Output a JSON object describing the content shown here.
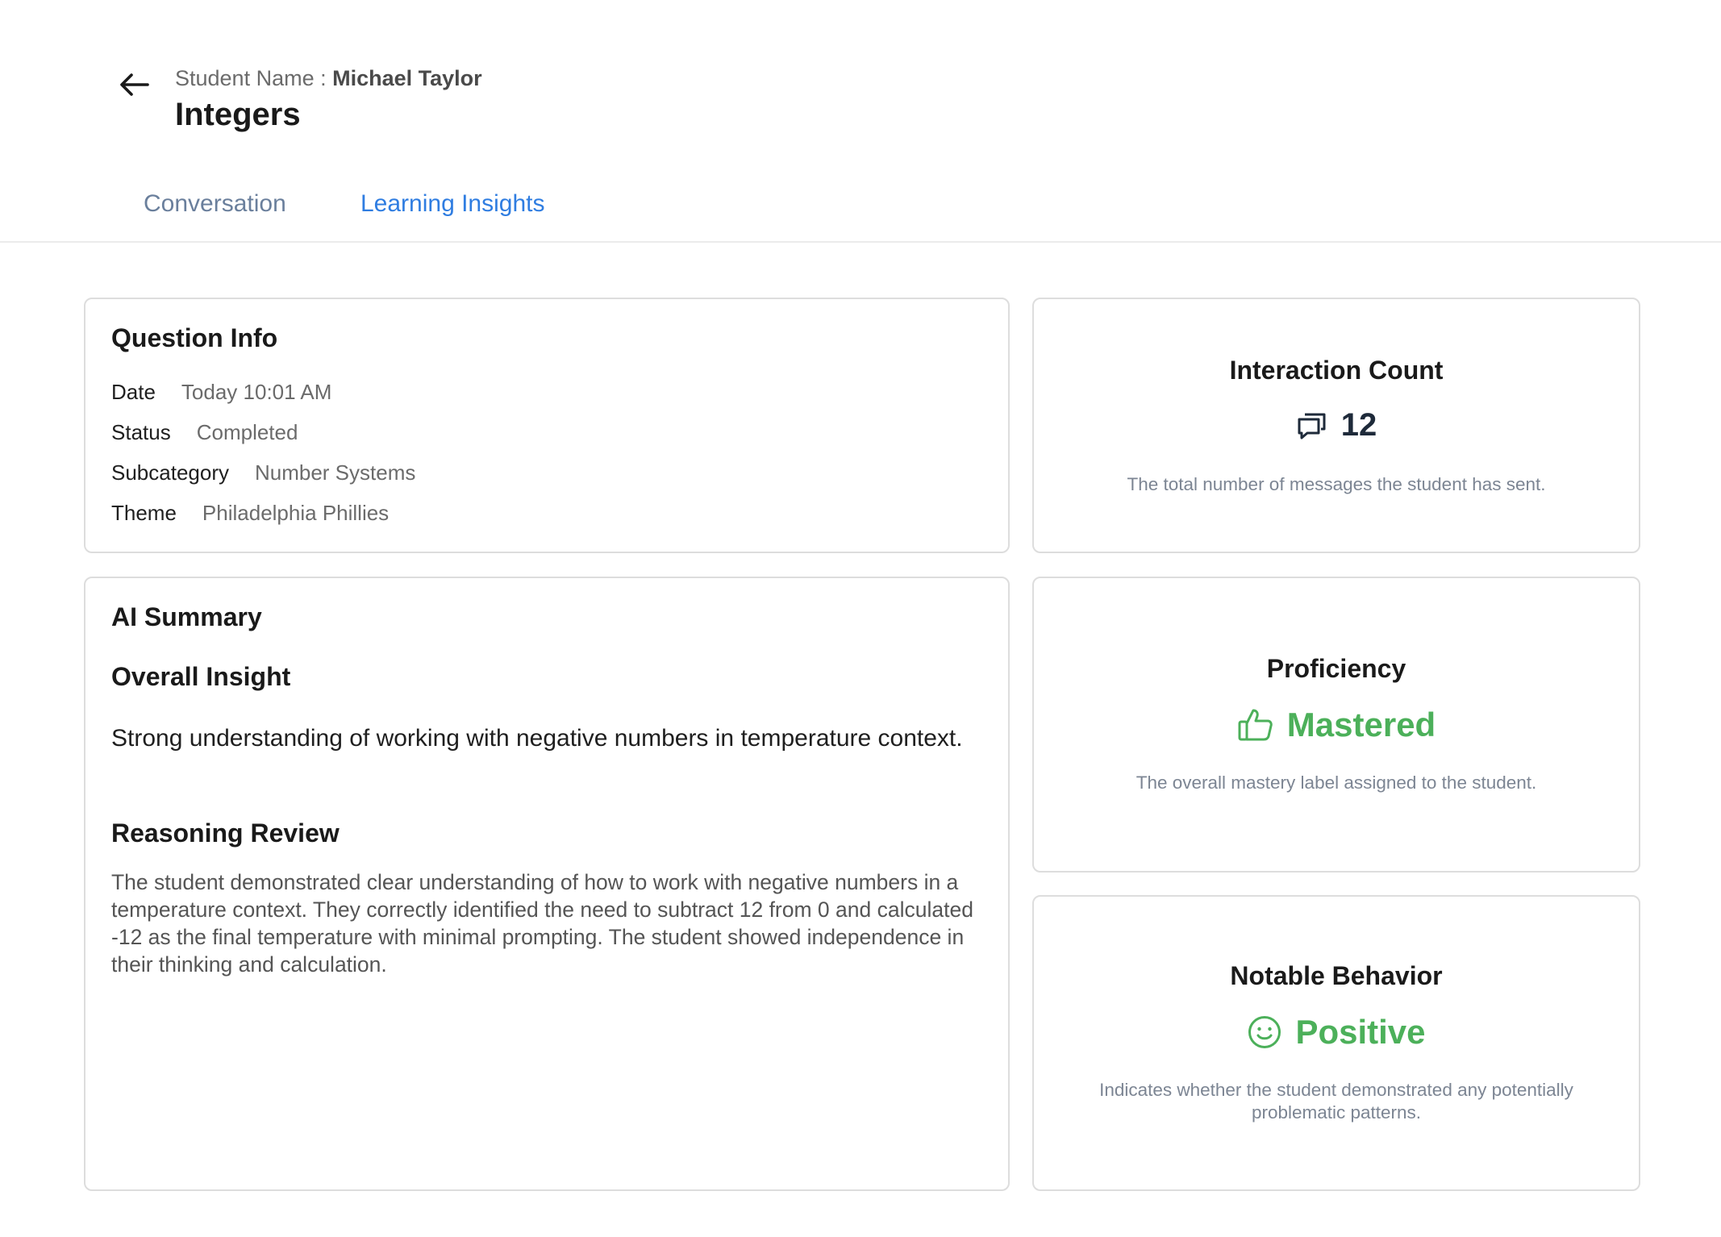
{
  "header": {
    "student_label": "Student Name : ",
    "student_name": "Michael Taylor",
    "title": "Integers"
  },
  "tabs": [
    {
      "label": "Conversation",
      "active": false
    },
    {
      "label": "Learning Insights",
      "active": true
    }
  ],
  "question_info": {
    "title": "Question Info",
    "rows": [
      {
        "label": "Date",
        "value": "Today 10:01 AM"
      },
      {
        "label": "Status",
        "value": "Completed"
      },
      {
        "label": "Subcategory",
        "value": "Number Systems"
      },
      {
        "label": "Theme",
        "value": "Philadelphia Phillies"
      }
    ]
  },
  "ai_summary": {
    "title": "AI Summary",
    "overall_heading": "Overall Insight",
    "overall_text": "Strong understanding of working with negative numbers in temperature context.",
    "reasoning_heading": "Reasoning Review",
    "reasoning_text": "The student demonstrated clear understanding of how to work with negative numbers in a temperature context. They correctly identified the need to subtract 12 from 0 and calculated -12 as the final temperature with minimal prompting. The student showed independence in their thinking and calculation."
  },
  "interaction_count": {
    "title": "Interaction Count",
    "value": "12",
    "icon": "chat-bubbles-icon",
    "description": "The total number of messages the student has sent."
  },
  "proficiency": {
    "title": "Proficiency",
    "value": "Mastered",
    "icon": "thumbs-up-icon",
    "description": "The overall mastery label assigned to the student."
  },
  "notable_behavior": {
    "title": "Notable Behavior",
    "value": "Positive",
    "icon": "smiley-icon",
    "description": "Indicates whether the student demonstrated any potentially problematic patterns."
  },
  "colors": {
    "accent_blue": "#2f7de1",
    "positive_green": "#4cb05a",
    "border": "#dddddd"
  }
}
